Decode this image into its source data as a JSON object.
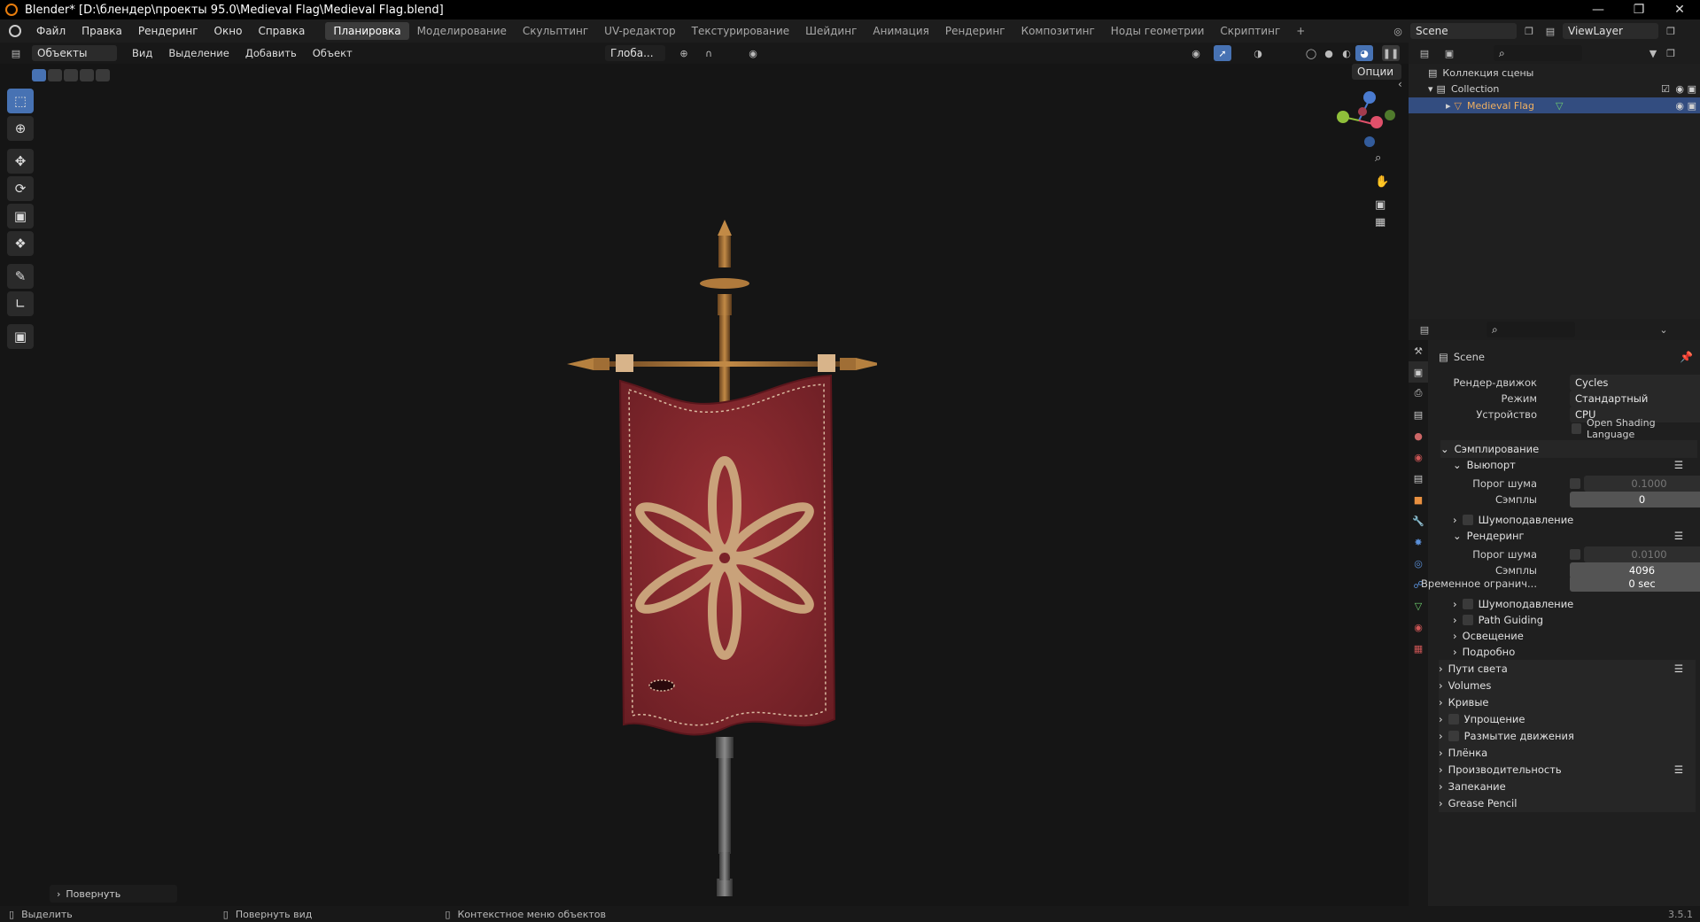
{
  "window": {
    "title": "Blender* [D:\\блендер\\проекты 95.0\\Medieval Flag\\Medieval Flag.blend]"
  },
  "menu": [
    "Файл",
    "Правка",
    "Рендеринг",
    "Окно",
    "Справка"
  ],
  "workspaces": [
    "Планировка",
    "Моделирование",
    "Скульптинг",
    "UV-редактор",
    "Текстурирование",
    "Шейдинг",
    "Анимация",
    "Рендеринг",
    "Композитинг",
    "Ноды геометрии",
    "Скриптинг"
  ],
  "workspace_add": "+",
  "scene_field": "Scene",
  "viewlayer_field": "ViewLayer",
  "viewport_header": {
    "mode": "Объекты",
    "menus": [
      "Вид",
      "Выделение",
      "Добавить",
      "Объект"
    ],
    "orientation": "Глоба...",
    "options": "Опции"
  },
  "outliner": {
    "scene_collection": "Коллекция сцены",
    "collection": "Collection",
    "object": "Medieval Flag"
  },
  "props": {
    "context": "Scene",
    "render_engine_label": "Рендер-движок",
    "render_engine": "Cycles",
    "mode_label": "Режим",
    "mode": "Стандартный",
    "device_label": "Устройство",
    "device": "CPU",
    "osl": "Open Shading Language",
    "sampling": "Сэмплирование",
    "viewport": "Выюпорт",
    "noise_label": "Порог шума",
    "vp_noise": "0.1000",
    "samples_label": "Сэмплы",
    "vp_samples": "0",
    "denoise": "Шумоподавление",
    "render": "Рендеринг",
    "r_noise": "0.0100",
    "r_samples": "4096",
    "time_label": "Временное огранич...",
    "time": "0 sec",
    "r_denoise": "Шумоподавление",
    "path_guiding": "Path Guiding",
    "lights": "Освещение",
    "advanced": "Подробно",
    "sections": [
      "Пути света",
      "Volumes",
      "Кривые",
      "Упрощение",
      "Размытие движения",
      "Плёнка",
      "Производительность",
      "Запекание",
      "Grease Pencil"
    ]
  },
  "last_op": "Повернуть",
  "status": {
    "select": "Выделить",
    "rotate": "Повернуть вид",
    "context": "Контекстное меню объектов",
    "version": "3.5.1"
  },
  "colors": {
    "accent": "#4772b3",
    "banner": "#8a2a2f",
    "emblem": "#c9a27a",
    "pole": "#a8743a"
  }
}
